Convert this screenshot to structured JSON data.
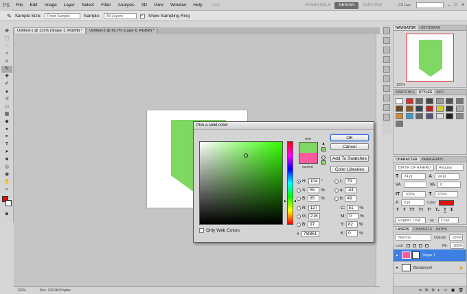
{
  "app": {
    "logo": "PS",
    "menus": [
      "File",
      "Edit",
      "Image",
      "Layer",
      "Select",
      "Filter",
      "Analysis",
      "3D",
      "View",
      "Window",
      "Help"
    ],
    "zoom_top": "100%",
    "workspaces": [
      "ESSENTIALS",
      "DESIGN",
      "PAINTING"
    ],
    "cs_live": "CS Live"
  },
  "options": {
    "sample_size_label": "Sample Size:",
    "sample_size_value": "Point Sample",
    "sample_label": "Sample:",
    "sample_value": "All Layers",
    "show_ring_label": "Show Sampling Ring"
  },
  "tabs": [
    {
      "label": "Untitled-1 @ 121% (Shape 1, RGB/8) *"
    },
    {
      "label": "Untitled-2 @ 66.7% (Layer 6, RGB/8) *"
    }
  ],
  "status": {
    "zoom": "121%",
    "doc": "Doc: 192.0K/0 bytes"
  },
  "dialog": {
    "title": "Pick a solid color:",
    "ok": "OK",
    "cancel": "Cancel",
    "add_swatches": "Add To Swatches",
    "color_libraries": "Color Libraries",
    "new_label": "new",
    "current_label": "current",
    "h_label": "H:",
    "h_val": "104",
    "h_unit": "°",
    "s_label": "S:",
    "s_val": "55",
    "s_unit": "%",
    "b_label": "B:",
    "b_val": "85",
    "b_unit": "%",
    "r_label": "R:",
    "r_val": "127",
    "g_label": "G:",
    "g_val": "216",
    "bb_label": "B:",
    "bb_val": "97",
    "l_label": "L:",
    "l_val": "79",
    "a_label": "a:",
    "a_val": "-44",
    "b2_label": "b:",
    "b2_val": "49",
    "c_label": "C:",
    "c_val": "51",
    "m_label": "M:",
    "m_val": "0",
    "y_label": "Y:",
    "y_val": "82",
    "k_label": "K:",
    "k_val": "0",
    "pct": "%",
    "hex_label": "#",
    "hex_val": "7fd861",
    "web_only": "Only Web Colors",
    "new_color": "#7fd861",
    "current_color": "#ff5aa0"
  },
  "navigator": {
    "tabs": [
      "NAVIGATOR",
      "HISTOGRAM"
    ],
    "zoom": "121%"
  },
  "swatches": {
    "tabs": [
      "SWATCHES",
      "STYLES",
      "INFO"
    ]
  },
  "character": {
    "tabs": [
      "CHARACTER",
      "PARAGRAPH"
    ],
    "font": "BIRTH OF A HERO",
    "style": "Regular",
    "size": "24 pt",
    "leading": "24 pt",
    "tracking": "0",
    "scale": "0 pt",
    "vscale": "100%",
    "hscale": "100%",
    "color_label": "Color:",
    "lang": "English: USA",
    "aa_label": "aa",
    "aa": "Crisp"
  },
  "layers": {
    "tabs": [
      "LAYERS",
      "CHANNELS",
      "PATHS"
    ],
    "blend": "Normal",
    "opacity_label": "Opacity:",
    "opacity": "100%",
    "lock_label": "Lock:",
    "fill_label": "Fill:",
    "fill": "100%",
    "items": [
      {
        "name": "Shape 1"
      },
      {
        "name": "Background"
      }
    ]
  },
  "colors": {
    "accent": "#3d7fe3",
    "shape_green": "#7fd861",
    "pink": "#ff5aa0",
    "fg": "#e01010"
  }
}
